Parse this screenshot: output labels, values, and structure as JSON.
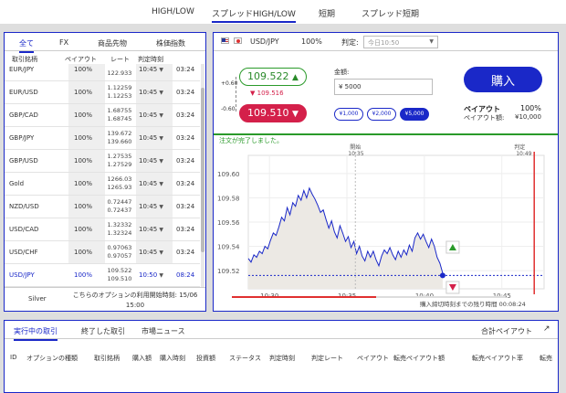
{
  "top_tabs": [
    "HIGH/LOW",
    "スプレッドHIGH/LOW",
    "短期",
    "スプレッド短期"
  ],
  "left_panel": {
    "tabs": [
      "全て",
      "FX",
      "商品先物",
      "株価指数"
    ],
    "headers": [
      "取引銘柄",
      "ペイアウト",
      "レート",
      "判定時刻"
    ],
    "rows": [
      {
        "symbol": "EUR/JPY",
        "payout": "100%",
        "rate_high": "",
        "rate_low": "122.933",
        "time": "10:45",
        "remaining": "03:24"
      },
      {
        "symbol": "EUR/USD",
        "payout": "100%",
        "rate_high": "1.12259",
        "rate_low": "1.12253",
        "time": "10:45",
        "remaining": "03:24"
      },
      {
        "symbol": "GBP/CAD",
        "payout": "100%",
        "rate_high": "1.68755",
        "rate_low": "1.68745",
        "time": "10:45",
        "remaining": "03:24"
      },
      {
        "symbol": "GBP/JPY",
        "payout": "100%",
        "rate_high": "139.672",
        "rate_low": "139.660",
        "time": "10:45",
        "remaining": "03:24"
      },
      {
        "symbol": "GBP/USD",
        "payout": "100%",
        "rate_high": "1.27535",
        "rate_low": "1.27529",
        "time": "10:45",
        "remaining": "03:24"
      },
      {
        "symbol": "Gold",
        "payout": "100%",
        "rate_high": "1266.03",
        "rate_low": "1265.93",
        "time": "10:45",
        "remaining": "03:24"
      },
      {
        "symbol": "NZD/USD",
        "payout": "100%",
        "rate_high": "0.72447",
        "rate_low": "0.72437",
        "time": "10:45",
        "remaining": "03:24"
      },
      {
        "symbol": "USD/CAD",
        "payout": "100%",
        "rate_high": "1.32332",
        "rate_low": "1.32324",
        "time": "10:45",
        "remaining": "03:24"
      },
      {
        "symbol": "USD/CHF",
        "payout": "100%",
        "rate_high": "0.97063",
        "rate_low": "0.97057",
        "time": "10:45",
        "remaining": "03:24"
      },
      {
        "symbol": "USD/JPY",
        "payout": "100%",
        "rate_high": "109.522",
        "rate_low": "109.510",
        "time": "10:50",
        "remaining": "08:24"
      }
    ],
    "footer_symbol": "Silver",
    "footer_note_line1": "こちらのオプションの利用開始時刻: 15/06",
    "footer_note_line2": "15:00"
  },
  "right_panel": {
    "pair": "USD/JPY",
    "payout": "100%",
    "judge_label": "判定:",
    "judge_select": "今日10:50",
    "scale_top": "+0.60",
    "scale_bottom": "-0.60",
    "price_high": "109.522",
    "price_prev": "109.516",
    "price_low": "109.510",
    "amount_label": "金額:",
    "amount_value": "¥ 5000",
    "chips": [
      "¥1,000",
      "¥2,000",
      "¥5,000"
    ],
    "buy_label": "購入",
    "payout_label": "ペイアウト",
    "payout_value": "100%",
    "payout_amount_label": "ペイアウト額:",
    "payout_amount_value": "¥10,000",
    "success_msg": "注文が完了しました。",
    "chart_start_label": "開始",
    "chart_start_time": "10:35",
    "chart_judge_label": "判定",
    "chart_judge_time": "10:49",
    "remaining_label": "購入締切時刻までの残り時間 00:08:24"
  },
  "chart_data": {
    "type": "line",
    "yticks": [
      "109.60",
      "109.58",
      "109.56",
      "109.54",
      "109.52"
    ],
    "xticks": [
      "10:30",
      "10:35",
      "10:40",
      "10:45"
    ],
    "ylim": [
      109.505,
      109.615
    ],
    "xlim": [
      0,
      21
    ],
    "current_rate": 109.516,
    "y": [
      109.53,
      109.527,
      109.533,
      109.531,
      109.536,
      109.534,
      109.54,
      109.538,
      109.545,
      109.551,
      109.549,
      109.556,
      109.564,
      109.561,
      109.572,
      109.566,
      109.576,
      109.573,
      109.582,
      109.578,
      109.586,
      109.58,
      109.588,
      109.583,
      109.579,
      109.574,
      109.568,
      109.57,
      109.562,
      109.555,
      109.561,
      109.552,
      109.547,
      109.557,
      109.551,
      109.544,
      109.548,
      109.539,
      109.544,
      109.534,
      109.54,
      109.532,
      109.528,
      109.536,
      109.531,
      109.536,
      109.529,
      109.524,
      109.532,
      109.537,
      109.534,
      109.539,
      109.533,
      109.529,
      109.536,
      109.531,
      109.537,
      109.533,
      109.541,
      109.536,
      109.547,
      109.551,
      109.546,
      109.55,
      109.544,
      109.539,
      109.546,
      109.54,
      109.531,
      109.526,
      109.518
    ],
    "colors": {
      "line": "#1a28c8",
      "fill": "#ece9e4",
      "judge": "#e03030",
      "up": "#2a9a2a",
      "down": "#d4204a"
    }
  },
  "bottom_panel": {
    "tabs": [
      "実行中の取引",
      "終了した取引",
      "市場ニュース"
    ],
    "total_payout": "合計ペイアウト",
    "headers": [
      "ID",
      "オプションの種類",
      "取引銘柄",
      "購入額",
      "購入時刻",
      "投資額",
      "ステータス",
      "判定時刻",
      "判定レート",
      "ペイアウト",
      "転売ペイアウト額",
      "転売ペイアウト率",
      "転売"
    ]
  }
}
